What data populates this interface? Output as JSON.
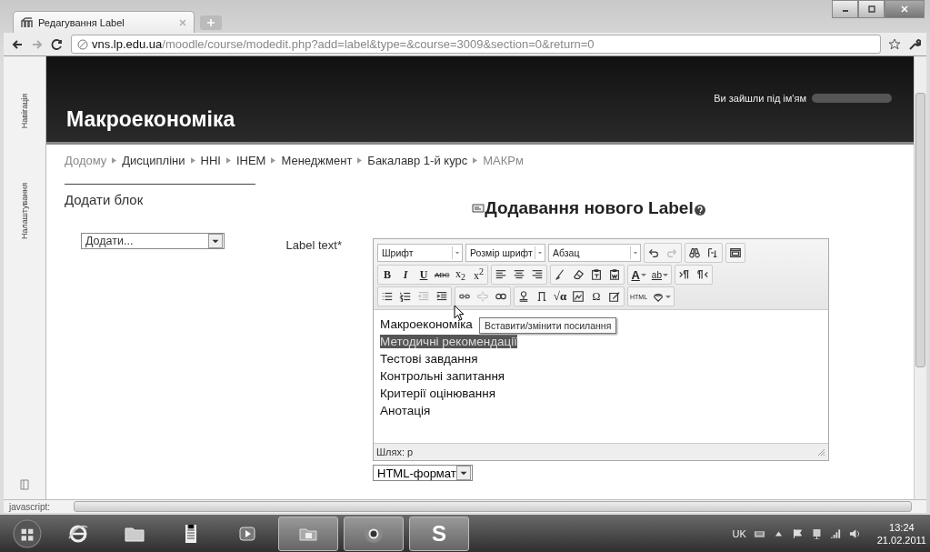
{
  "browser": {
    "tab_title": "Редагування Label",
    "url_host": "vns.lp.edu.ua",
    "url_path": "/moodle/course/modedit.php?add=label&type=&course=3009&section=0&return=0",
    "status_text": "javascript:"
  },
  "side_rail": [
    "Навігація",
    "Налаштування"
  ],
  "header": {
    "site_title": "Макроекономіка",
    "login_text": "Ви зайшли під ім'ям"
  },
  "breadcrumb": [
    "Додому",
    "Дисципліни",
    "ННІ",
    "ІНЕМ",
    "Менеджмент",
    "Бакалавр 1-й курс",
    "МАКРм"
  ],
  "add_block": {
    "title": "Додати блок",
    "select": "Додати..."
  },
  "form": {
    "heading": "Додавання нового Label",
    "field_label": "Label text*",
    "format_select": "HTML-формат"
  },
  "editor": {
    "toolbar": [
      [
        [
          {
            "kind": "select",
            "label": "Шрифт",
            "disabled": false
          },
          {
            "kind": "select",
            "label": "Розмір шрифт",
            "disabled": false
          },
          {
            "kind": "select",
            "label": "Абзац",
            "disabled": false
          }
        ],
        [
          {
            "kind": "undo",
            "disabled": false
          },
          {
            "kind": "redo",
            "disabled": true
          }
        ],
        [
          {
            "kind": "find",
            "disabled": false
          },
          {
            "kind": "replace",
            "disabled": false
          }
        ],
        [
          {
            "kind": "fullscreen",
            "disabled": false
          }
        ]
      ],
      [
        [
          {
            "kind": "bold",
            "label": "B",
            "disabled": false
          },
          {
            "kind": "italic",
            "label": "I",
            "disabled": false
          },
          {
            "kind": "underline",
            "label": "U",
            "disabled": false
          },
          {
            "kind": "strike",
            "label": "ABC",
            "disabled": false
          },
          {
            "kind": "sub",
            "label": "x$_{2}$",
            "disabled": false
          },
          {
            "kind": "sup",
            "label": "x$^{2}$",
            "disabled": false
          }
        ],
        [
          {
            "kind": "justifyleft",
            "disabled": false
          },
          {
            "kind": "justifycenter",
            "disabled": false
          },
          {
            "kind": "justifyright",
            "disabled": false
          }
        ],
        [
          {
            "kind": "cleanup",
            "disabled": false
          },
          {
            "kind": "eraser",
            "disabled": false
          },
          {
            "kind": "pastetext",
            "disabled": false
          },
          {
            "kind": "pasteword",
            "disabled": false
          }
        ],
        [
          {
            "kind": "forecolor",
            "label": "A",
            "disabled": false
          },
          {
            "kind": "backcolor",
            "label": "ab",
            "disabled": false
          }
        ],
        [
          {
            "kind": "ltr",
            "disabled": false
          },
          {
            "kind": "rtl",
            "disabled": false
          }
        ]
      ],
      [
        [
          {
            "kind": "bullist",
            "disabled": false
          },
          {
            "kind": "numlist",
            "disabled": false
          },
          {
            "kind": "outdent",
            "disabled": true
          },
          {
            "kind": "indent",
            "disabled": false
          }
        ],
        [
          {
            "kind": "link",
            "disabled": false
          },
          {
            "kind": "unlink",
            "disabled": true
          },
          {
            "kind": "anchor",
            "disabled": false
          }
        ],
        [
          {
            "kind": "image",
            "disabled": false
          },
          {
            "kind": "media",
            "disabled": false
          },
          {
            "kind": "equation",
            "label": "√α",
            "disabled": false
          },
          {
            "kind": "framed",
            "disabled": false
          },
          {
            "kind": "charmap",
            "label": "Ω",
            "disabled": false
          },
          {
            "kind": "edit",
            "disabled": false
          }
        ],
        [
          {
            "kind": "code",
            "label": "HTML",
            "disabled": false
          },
          {
            "kind": "spell",
            "disabled": false
          }
        ]
      ]
    ],
    "lines": [
      {
        "text": "Макроекономіка",
        "selected": false
      },
      {
        "text": "Методичні рекомендації",
        "selected": true
      },
      {
        "text": "Тестові завдання",
        "selected": false
      },
      {
        "text": "Контрольні запитання",
        "selected": false
      },
      {
        "text": "Критерії оцінювання",
        "selected": false
      },
      {
        "text": "Анотація",
        "selected": false
      }
    ],
    "tooltip": "Вставити/змінити посилання",
    "path": "Шлях: p"
  },
  "taskbar": {
    "items": [
      {
        "kind": "start",
        "running": false
      },
      {
        "kind": "ie",
        "running": false
      },
      {
        "kind": "folder",
        "running": false
      },
      {
        "kind": "notepad",
        "running": false
      },
      {
        "kind": "media",
        "running": false
      },
      {
        "kind": "explorer",
        "running": true
      },
      {
        "kind": "chrome",
        "running": true
      },
      {
        "kind": "skype",
        "label": "S",
        "running": true
      }
    ],
    "keyboard": "UK",
    "time": "13:24",
    "date": "21.02.2011"
  }
}
